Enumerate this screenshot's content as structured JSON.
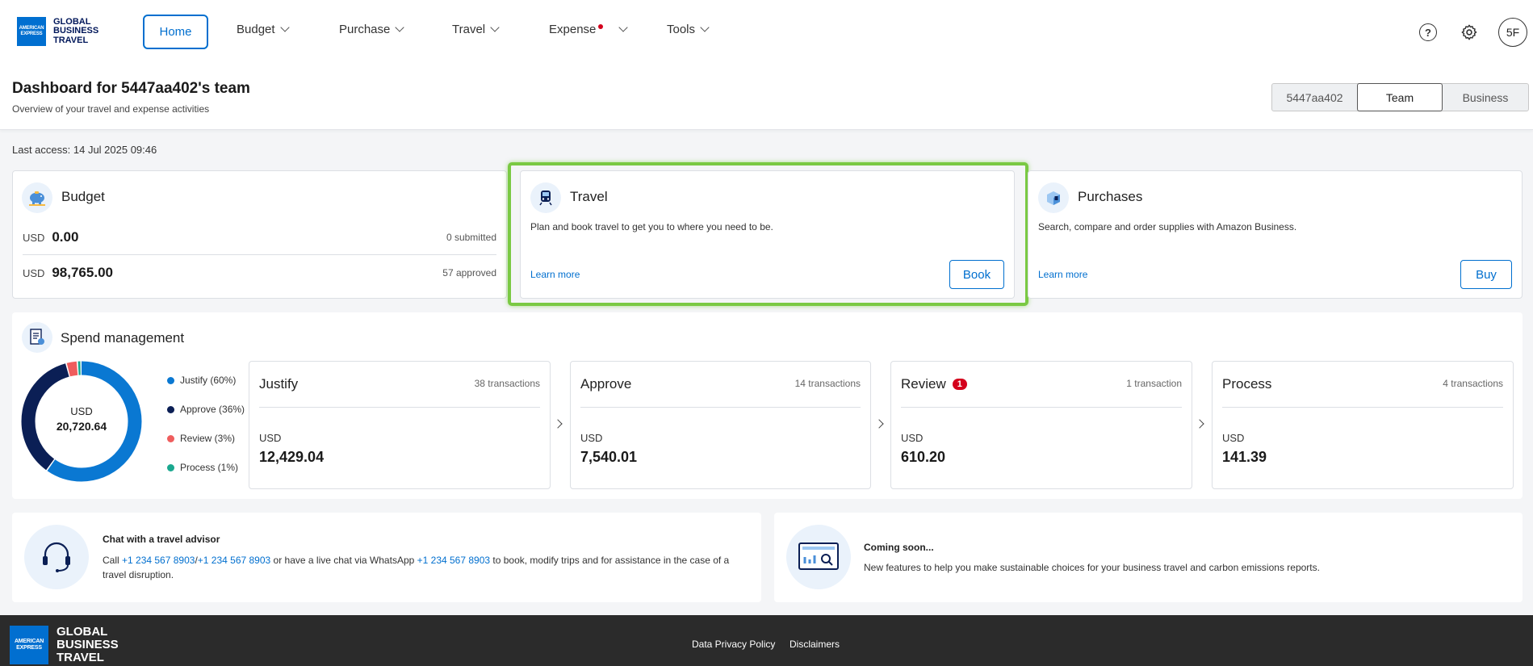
{
  "brand": {
    "logo_box_line1": "AMERICAN",
    "logo_box_line2": "EXPRESS",
    "line1": "GLOBAL",
    "line2": "BUSINESS",
    "line3": "TRAVEL"
  },
  "nav": {
    "home": "Home",
    "budget": "Budget",
    "purchase": "Purchase",
    "travel": "Travel",
    "expense": "Expense",
    "tools": "Tools",
    "help_icon": "?",
    "avatar_initials": "5F"
  },
  "header": {
    "title": "Dashboard for 5447aa402's team",
    "subtitle": "Overview of your travel and expense activities",
    "scope_tabs": [
      "5447aa402",
      "Team",
      "Business"
    ],
    "selected_scope": "Team"
  },
  "last_access": "Last access: 14 Jul 2025 09:46",
  "budget_card": {
    "title": "Budget",
    "rows": [
      {
        "currency": "USD",
        "amount": "0.00",
        "status": "0 submitted"
      },
      {
        "currency": "USD",
        "amount": "98,765.00",
        "status": "57 approved"
      }
    ]
  },
  "travel_card": {
    "title": "Travel",
    "description": "Plan and book travel to get you to where you need to be.",
    "learn_more": "Learn more",
    "button": "Book"
  },
  "purchases_card": {
    "title": "Purchases",
    "description": "Search, compare and order supplies with Amazon Business.",
    "learn_more": "Learn more",
    "button": "Buy"
  },
  "spend": {
    "title": "Spend management",
    "total_currency": "USD",
    "total_amount": "20,720.64",
    "legend": [
      {
        "label": "Justify (60%)",
        "color": "#0a78d2",
        "fraction": 0.6
      },
      {
        "label": "Approve (36%)",
        "color": "#0b1f55",
        "fraction": 0.36
      },
      {
        "label": "Review (3%)",
        "color": "#ef5d5d",
        "fraction": 0.03
      },
      {
        "label": "Process (1%)",
        "color": "#1aa88f",
        "fraction": 0.01
      }
    ],
    "stages": [
      {
        "title": "Justify",
        "count": "38 transactions",
        "currency": "USD",
        "amount": "12,429.04",
        "badge": ""
      },
      {
        "title": "Approve",
        "count": "14 transactions",
        "currency": "USD",
        "amount": "7,540.01",
        "badge": ""
      },
      {
        "title": "Review",
        "count": "1 transaction",
        "currency": "USD",
        "amount": "610.20",
        "badge": "1"
      },
      {
        "title": "Process",
        "count": "4 transactions",
        "currency": "USD",
        "amount": "141.39",
        "badge": ""
      }
    ]
  },
  "advisor": {
    "title": "Chat with a travel advisor",
    "text_call": "Call ",
    "phone1": "+1 234 567 8903",
    "sep": "/",
    "phone2": "+1 234 567 8903",
    "text_mid": " or have a live chat via WhatsApp ",
    "phone3": "+1 234 567 8903",
    "text_end": " to book, modify trips and for assistance in the case of a travel disruption."
  },
  "coming_soon": {
    "title": "Coming soon...",
    "text": "New features to help you make sustainable choices for your business travel and carbon emissions reports."
  },
  "footer": {
    "privacy": "Data Privacy Policy",
    "disclaimers": "Disclaimers"
  },
  "colors": {
    "accent": "#006fcf",
    "highlight": "#7ac943",
    "alert": "#d4001c",
    "footer_bg": "#2b2b2b"
  }
}
